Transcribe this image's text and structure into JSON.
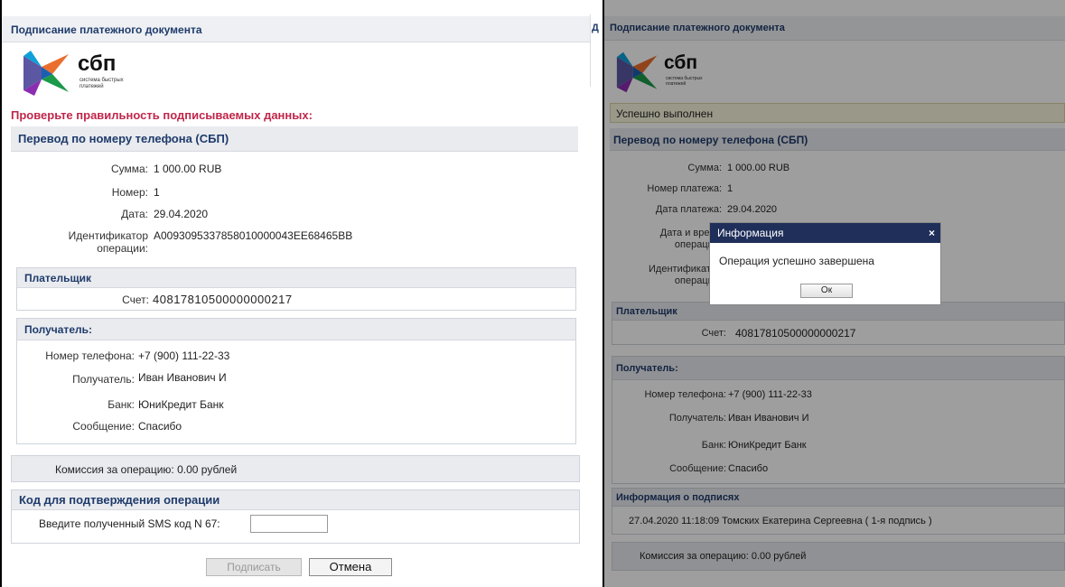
{
  "left": {
    "title": "Подписание платежного документа",
    "logo_text": "сбп",
    "logo_sub1": "система быстрых",
    "logo_sub2": "платежей",
    "warning": "Проверьте правильность подписываемых данных:",
    "transfer": {
      "header": "Перевод по номеру телефона (СБП)",
      "rows": [
        {
          "label": "Сумма:",
          "value": "1 000.00 RUB"
        },
        {
          "label": "Номер:",
          "value": "1"
        },
        {
          "label": "Дата:",
          "value": "29.04.2020"
        },
        {
          "label1": "Идентификатор",
          "label2": "операции:",
          "value": "A0093095337858010000043EE68465BB"
        }
      ]
    },
    "payer": {
      "header": "Плательщик",
      "label": "Счет:",
      "value": "40817810500000000217"
    },
    "recipient": {
      "header": "Получатель:",
      "rows": [
        {
          "label": "Номер телефона:",
          "value": "+7 (900) 111-22-33"
        },
        {
          "label": "Получатель:",
          "value": "Иван Иванович И"
        },
        {
          "label": "Банк:",
          "value": "ЮниКредит Банк"
        },
        {
          "label": "Сообщение:",
          "value": "Спасибо"
        }
      ]
    },
    "commission": "Комиссия за операцию: 0.00 рублей",
    "code": {
      "header": "Код для подтверждения операции",
      "label": "Введите полученный SMS код N 67:",
      "value": ""
    },
    "sign_button": "Подписать",
    "cancel_button": "Отмена"
  },
  "behind_letter": "Д",
  "right": {
    "title": "Подписание платежного документа",
    "success": "Успешно выполнен",
    "transfer": {
      "header": "Перевод по номеру телефона (СБП)",
      "rows": [
        {
          "label": "Сумма:",
          "value": "1 000.00 RUB"
        },
        {
          "label": "Номер платежа:",
          "value": "1"
        },
        {
          "label": "Дата платежа:",
          "value": "29.04.2020"
        },
        {
          "label1": "Дата и время",
          "label2": "операции:"
        },
        {
          "label1": "Идентификатор",
          "label2": "операции:"
        }
      ]
    },
    "payer": {
      "header": "Плательщик",
      "label": "Счет:",
      "value": "40817810500000000217"
    },
    "recipient": {
      "header": "Получатель:",
      "rows": [
        {
          "label": "Номер телефона:",
          "value": "+7 (900) 111-22-33"
        },
        {
          "label": "Получатель:",
          "value": "Иван Иванович И"
        },
        {
          "label": "Банк:",
          "value": "ЮниКредит Банк"
        },
        {
          "label": "Сообщение:",
          "value": "Спасибо"
        }
      ]
    },
    "signatures": {
      "header": "Информация о подписях",
      "entry": "27.04.2020 11:18:09 Томских Екатерина Сергеевна ( 1-я подпись )"
    },
    "commission": "Комиссия за операцию: 0.00 рублей",
    "dialog": {
      "title": "Информация",
      "close": "×",
      "message": "Операция успешно завершена",
      "ok": "Ок"
    }
  },
  "colors": {
    "title": "#1f3b6b",
    "warning": "#c0264a",
    "dialog_header": "#1f2f5a",
    "success_bg": "#f9f6dc"
  }
}
